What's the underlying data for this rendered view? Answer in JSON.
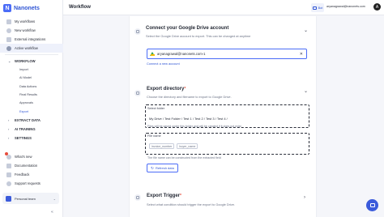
{
  "brand": {
    "name": "Nanonets"
  },
  "sidebar": {
    "top_items": [
      {
        "label": "My workflows"
      },
      {
        "label": "New workflow"
      },
      {
        "label": "External integrations"
      },
      {
        "label": "Active workflow"
      }
    ],
    "workflow_section": {
      "label": "WORKFLOW",
      "items": [
        {
          "label": "Import"
        },
        {
          "label": "AI Model"
        },
        {
          "label": "Data Actions"
        },
        {
          "label": "Final Results"
        },
        {
          "label": "Approvals"
        },
        {
          "label": "Export"
        }
      ]
    },
    "sections": [
      {
        "label": "EXTRACT DATA"
      },
      {
        "label": "AI TRAINING"
      },
      {
        "label": "SETTINGS"
      }
    ],
    "bottom_items": [
      {
        "label": "What's new"
      },
      {
        "label": "Documentation"
      },
      {
        "label": "Feedback"
      },
      {
        "label": "Support requests"
      }
    ],
    "team": {
      "label": "Personal team"
    }
  },
  "header": {
    "title": "Workflow",
    "chat_label": "Bot",
    "user_email": "aryanagrawal@nanonets.com",
    "user_initial": "A"
  },
  "steps": {
    "connect": {
      "title": "Connect your Google Drive account",
      "desc": "Select the Google Drive account to export. This can be changed at anytime",
      "account": "aryanagrawal@nanonets.com-1",
      "connect_new": "Connect a new account"
    },
    "directory": {
      "title": "Export directory",
      "desc": "Choose the directory and filename to export to Google Drive.",
      "folder_label": "Select folder",
      "folder_path": "My Drive / Test Folder / Test 1 / Test 2 / Test 3 / Test 4 /",
      "folder_hint": "Files will be saved under this folder and will be created if it does not exist",
      "file_label": "File name",
      "file_chips": [
        "invoice_number",
        "buyer_name"
      ],
      "file_hint": "The file name can be constructed from the extracted field",
      "refresh_label": "Refresh data"
    },
    "trigger": {
      "title": "Export Trigger",
      "desc": "Select what condition should trigger the export to Google Drive."
    }
  },
  "colors": {
    "accent": "#2f55d4",
    "required": "#e74c3c"
  }
}
